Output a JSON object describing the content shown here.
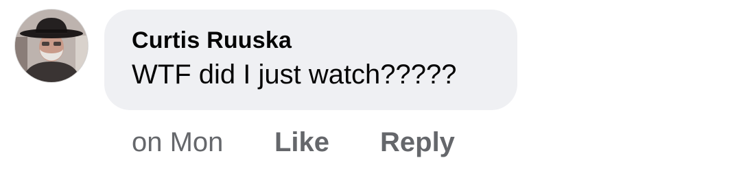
{
  "comment": {
    "author": "Curtis Ruuska",
    "text": "WTF did I just watch?????",
    "timestamp": "on Mon",
    "actions": {
      "like_label": "Like",
      "reply_label": "Reply"
    }
  },
  "colors": {
    "bubble_background": "#eff0f3",
    "text_primary": "#050505",
    "text_secondary": "#65676b"
  }
}
